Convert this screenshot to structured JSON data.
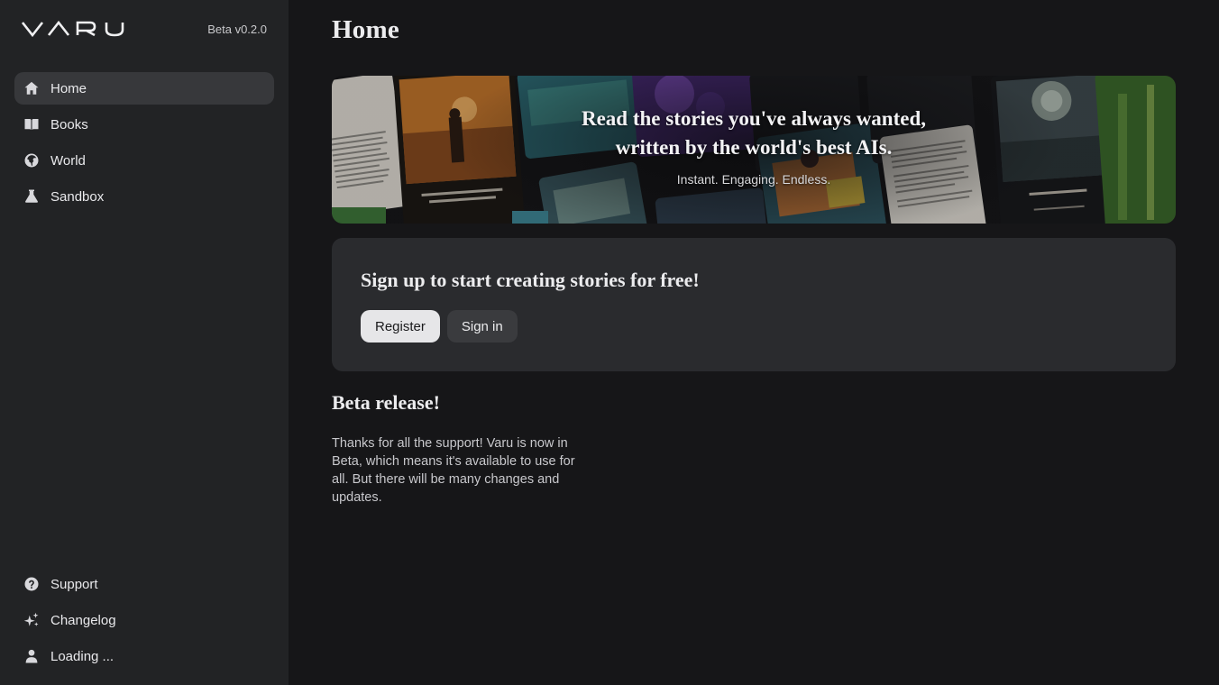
{
  "brand": {
    "name": "VARU",
    "version": "Beta v0.2.0"
  },
  "sidebar": {
    "items": [
      {
        "label": "Home",
        "icon": "home-icon",
        "active": true
      },
      {
        "label": "Books",
        "icon": "book-icon",
        "active": false
      },
      {
        "label": "World",
        "icon": "globe-icon",
        "active": false
      },
      {
        "label": "Sandbox",
        "icon": "flask-icon",
        "active": false
      }
    ],
    "bottom_items": [
      {
        "label": "Support",
        "icon": "help-icon"
      },
      {
        "label": "Changelog",
        "icon": "sparkles-icon"
      },
      {
        "label": "Loading ...",
        "icon": "user-icon"
      }
    ]
  },
  "main": {
    "title": "Home",
    "hero": {
      "headline": "Read the stories you've always wanted, written by the world's best AIs.",
      "tagline": "Instant. Engaging. Endless."
    },
    "signup": {
      "title": "Sign up to start creating stories for free!",
      "register_label": "Register",
      "signin_label": "Sign in"
    },
    "announcement": {
      "title": "Beta release!",
      "body": "Thanks for all the support! Varu is now in Beta, which means it's available to use for all. But there will be many changes and updates."
    }
  },
  "colors": {
    "sidebar_bg": "#222325",
    "main_bg": "#161618",
    "card_bg": "#2a2b2e",
    "active_item_bg": "#37383b",
    "primary_button_bg": "#e6e6e8"
  }
}
